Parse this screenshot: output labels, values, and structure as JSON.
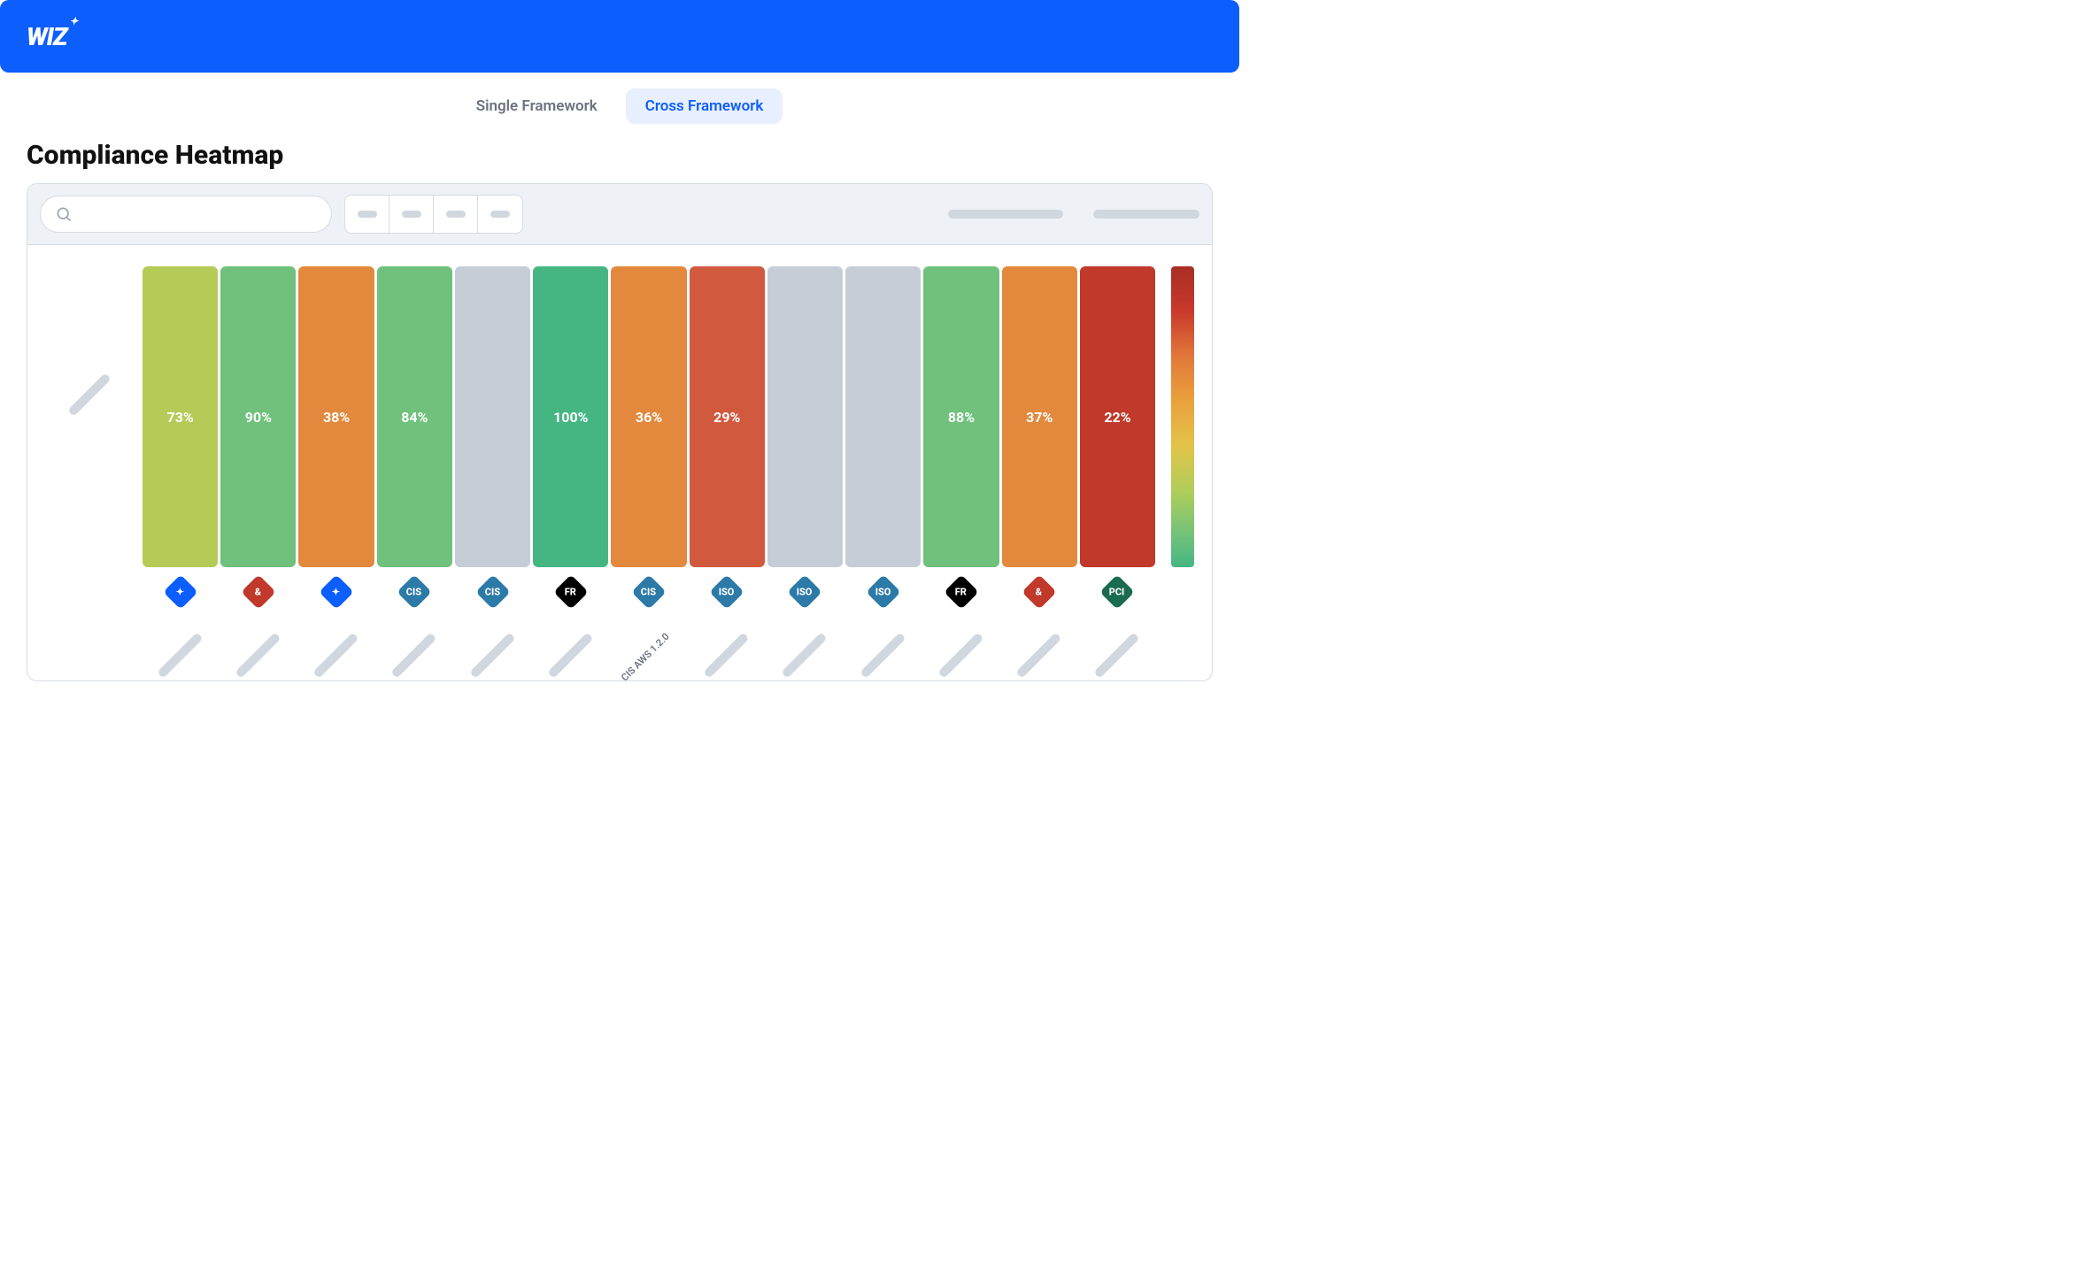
{
  "brand": "WIZ",
  "tabs": {
    "single": "Single Framework",
    "cross": "Cross Framework"
  },
  "title": "Compliance Heatmap",
  "chart_data": {
    "type": "heatmap",
    "title": "Compliance Heatmap",
    "rows": [
      ""
    ],
    "columns": [
      {
        "icon": "star",
        "icon_color": "#0d5eff",
        "label": ""
      },
      {
        "icon": "amp",
        "icon_color": "#c0392b",
        "label": ""
      },
      {
        "icon": "star",
        "icon_color": "#0d5eff",
        "label": ""
      },
      {
        "icon": "cis",
        "icon_color": "#2c7aa8",
        "label": ""
      },
      {
        "icon": "cis",
        "icon_color": "#2c7aa8",
        "label": ""
      },
      {
        "icon": "fr",
        "icon_color": "#000000",
        "label": ""
      },
      {
        "icon": "cis",
        "icon_color": "#2c7aa8",
        "label": "CIS AWS 1.2.0"
      },
      {
        "icon": "iso",
        "icon_color": "#2c7aa8",
        "label": ""
      },
      {
        "icon": "iso",
        "icon_color": "#2c7aa8",
        "label": ""
      },
      {
        "icon": "iso",
        "icon_color": "#2c7aa8",
        "label": ""
      },
      {
        "icon": "fr",
        "icon_color": "#000000",
        "label": ""
      },
      {
        "icon": "amp",
        "icon_color": "#c0392b",
        "label": ""
      },
      {
        "icon": "pci",
        "icon_color": "#1a6b4f",
        "label": ""
      }
    ],
    "values": [
      [
        73,
        90,
        38,
        84,
        null,
        100,
        36,
        29,
        null,
        null,
        88,
        37,
        22
      ]
    ],
    "value_suffix": "%",
    "colors": [
      [
        "#b4cc57",
        "#6fc17b",
        "#e3893d",
        "#6fc17b",
        "#c6cdd6",
        "#45b682",
        "#e3893d",
        "#d15a3e",
        "#c6cdd6",
        "#c6cdd6",
        "#6fc17b",
        "#e3893d",
        "#c0392b"
      ]
    ],
    "legend": {
      "type": "gradient",
      "low_color": "#45b682",
      "high_color": "#a92e24"
    }
  },
  "icon_text": {
    "star": "✦",
    "amp": "&",
    "cis": "CIS",
    "fr": "FR",
    "iso": "ISO",
    "pci": "PCI"
  }
}
